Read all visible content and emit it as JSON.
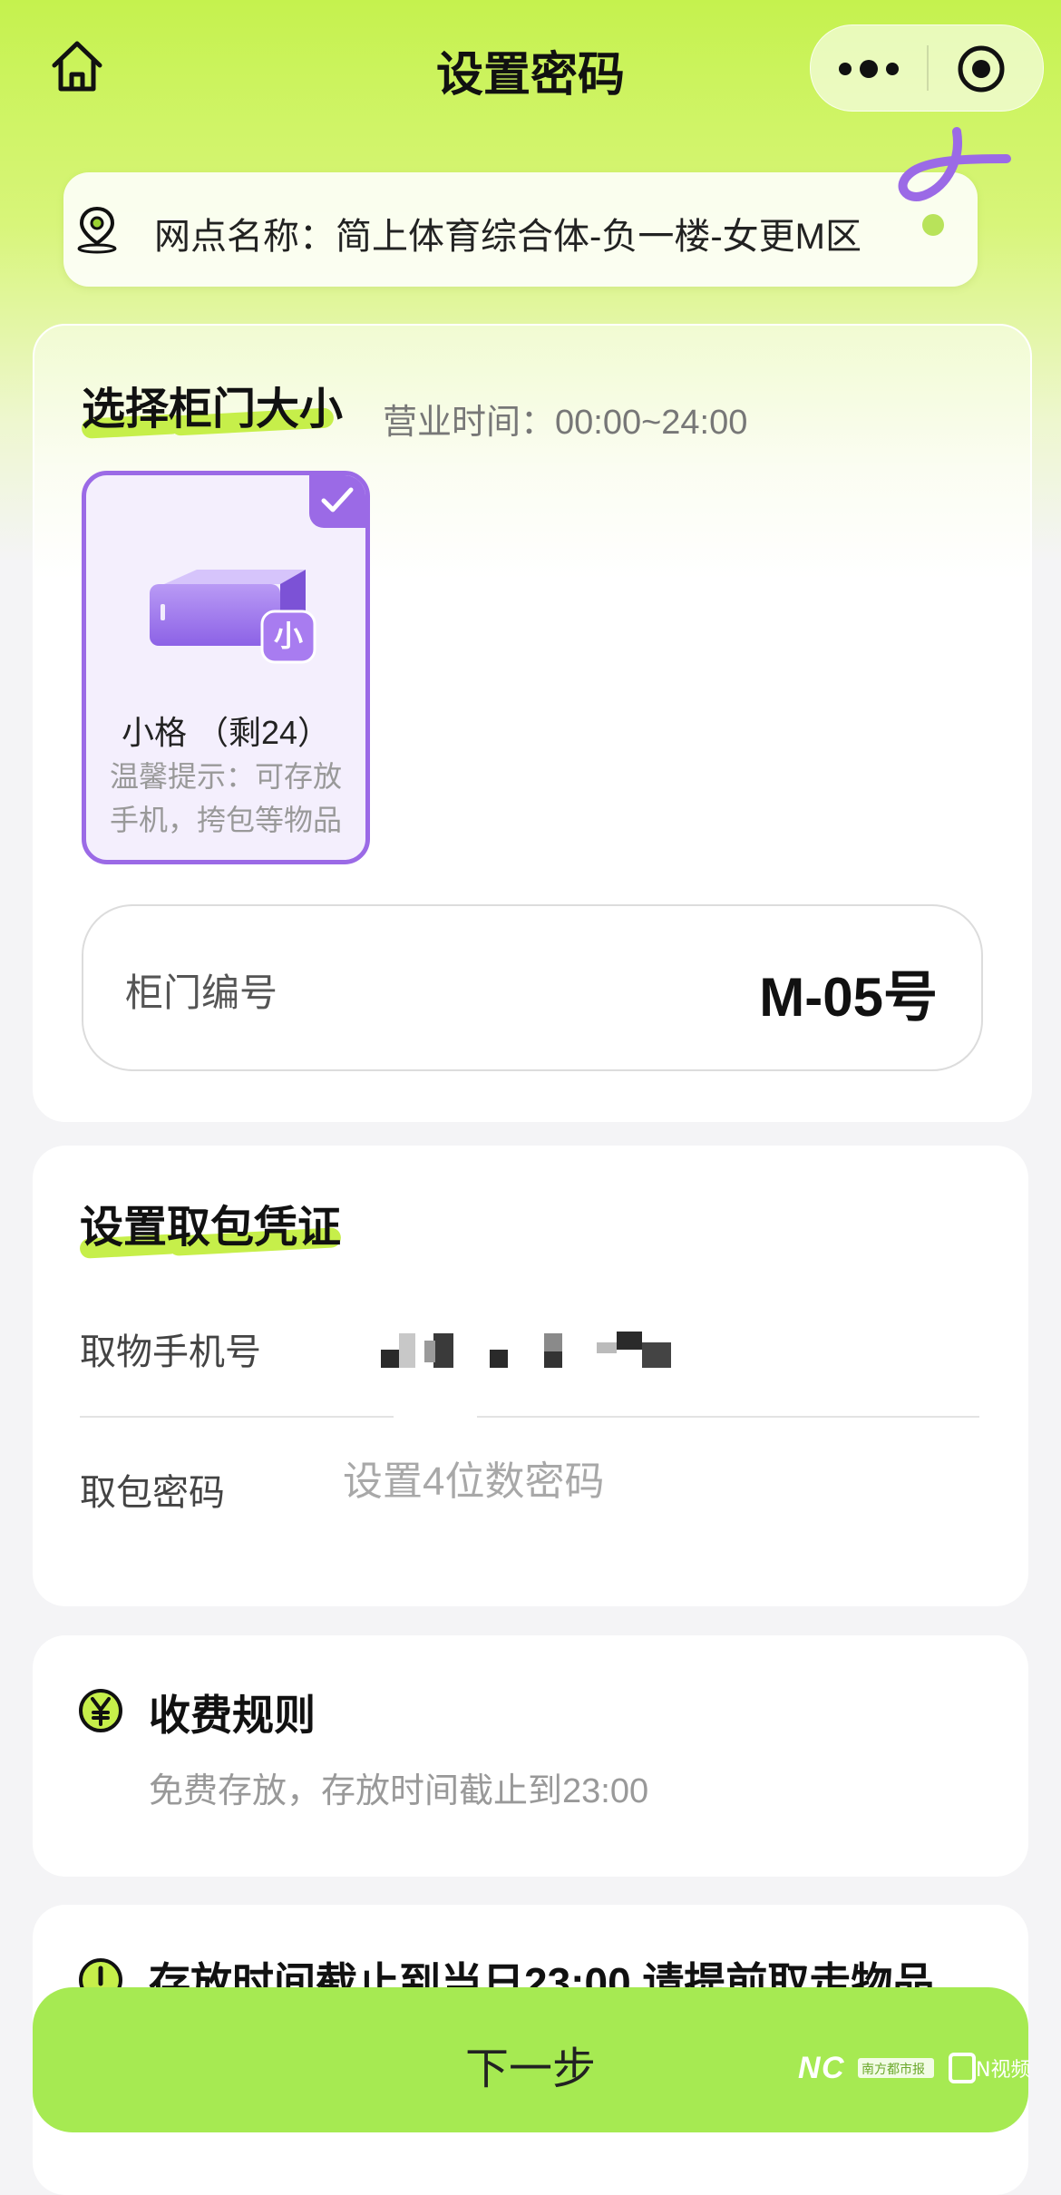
{
  "nav": {
    "title": "设置密码"
  },
  "location": {
    "text": "网点名称：简上体育综合体-负一楼-女更M区"
  },
  "size_section": {
    "title": "选择柜门大小",
    "hours": "营业时间：00:00~24:00",
    "option": {
      "badge": "小",
      "name": "小格 （剩24）",
      "tip_line1": "温馨提示：可存放",
      "tip_line2": "手机，挎包等物品",
      "selected": true
    },
    "door_label": "柜门编号",
    "door_value": "M-05号"
  },
  "credential_section": {
    "title": "设置取包凭证",
    "phone_label": "取物手机号",
    "password_label": "取包密码",
    "password_placeholder": "设置4位数密码"
  },
  "fee_section": {
    "title": "收费规则",
    "desc": "免费存放，存放时间截止到23:00"
  },
  "warning": {
    "text": "存放时间截止到当日23:00,请提前取走物品"
  },
  "footer": {
    "next_label": "下一步"
  },
  "watermark": {
    "left": "南方都市报",
    "right": "N视频"
  },
  "colors": {
    "accent_green": "#a6ea52",
    "purple": "#9b6ae6",
    "highlight": "#c6ef4a"
  },
  "icons": {
    "home": "home-icon",
    "more": "more-dots-icon",
    "close": "target-close-icon",
    "location": "location-pin-icon",
    "check": "check-icon",
    "fee": "yen-icon",
    "warning": "exclamation-icon"
  }
}
